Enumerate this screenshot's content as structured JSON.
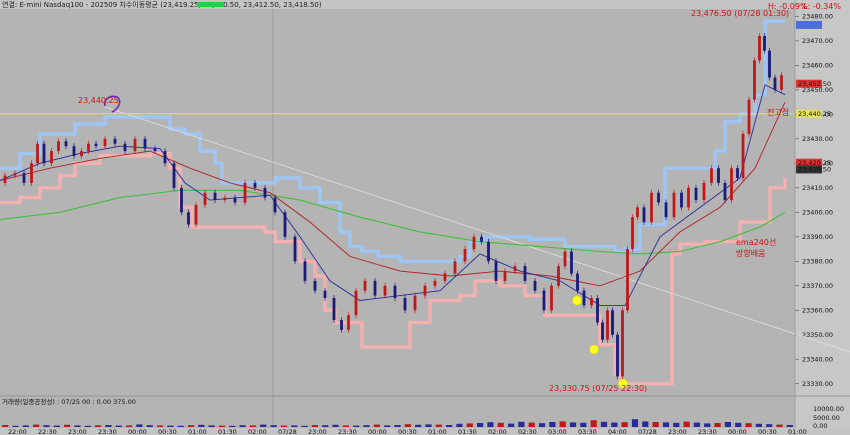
{
  "header": {
    "title": "연결: E-mini Nasdaq100 - 202509 차수이동평균  (23,419.25, 23,420.50, 23,412.50, 23,418.50)",
    "status_color": "#2ecc40"
  },
  "price_panel": {
    "high_label": "H: -0.09%",
    "low_label": "L: -0.34%",
    "last_label": "23,476.50 (07/28 01:30)",
    "low_annotation": "23,330.75 (07/25 22:30)",
    "level_label": "23,440.25",
    "level_left_label": "23,440.25",
    "red_badge_top": "23,452.50",
    "red_badge_mid": "23,420.25",
    "red_badge_mid2": "23,419.50",
    "annotation_high": "전고점",
    "annotation_ema_line1": "ema240선",
    "annotation_ema_line2": "방향배움"
  },
  "volume_panel": {
    "title": "거래량(일중공정성) : 07/25 00 : 0.00  375.00",
    "tick_labels": [
      "10000.00",
      "5000.00",
      "0.00"
    ]
  },
  "chart_data": {
    "type": "line",
    "ylim": [
      23325,
      23483
    ],
    "yticks": [
      23330,
      23340,
      23350,
      23360,
      23370,
      23380,
      23390,
      23400,
      23410,
      23420,
      23430,
      23440,
      23450,
      23460,
      23470,
      23480
    ],
    "xlabels": [
      "22:00",
      "22:30",
      "23:00",
      "23:30",
      "00:00",
      "00:30",
      "01:00",
      "01:30",
      "02:00",
      "07/28",
      "23:00",
      "23:30",
      "00:00",
      "00:30",
      "01:00",
      "01:30",
      "02:00",
      "02:30",
      "03:00",
      "03:30",
      "04:00",
      "07/28",
      "23:00",
      "23:30",
      "00:00",
      "00:30",
      "01:00"
    ],
    "key_level": 23440.25,
    "price": [
      [
        0,
        23412
      ],
      [
        10,
        23415
      ],
      [
        20,
        23416
      ],
      [
        28,
        23412
      ],
      [
        35,
        23420
      ],
      [
        40,
        23428
      ],
      [
        48,
        23420
      ],
      [
        55,
        23425
      ],
      [
        62,
        23429
      ],
      [
        70,
        23427
      ],
      [
        78,
        23423
      ],
      [
        85,
        23425
      ],
      [
        92,
        23428
      ],
      [
        100,
        23427
      ],
      [
        110,
        23430
      ],
      [
        120,
        23428
      ],
      [
        130,
        23425
      ],
      [
        140,
        23430
      ],
      [
        150,
        23426
      ],
      [
        160,
        23425
      ],
      [
        170,
        23420
      ],
      [
        178,
        23410
      ],
      [
        185,
        23400
      ],
      [
        192,
        23395
      ],
      [
        200,
        23403
      ],
      [
        210,
        23408
      ],
      [
        220,
        23405
      ],
      [
        230,
        23406
      ],
      [
        240,
        23404
      ],
      [
        250,
        23412
      ],
      [
        260,
        23410
      ],
      [
        270,
        23406
      ],
      [
        280,
        23400
      ],
      [
        290,
        23390
      ],
      [
        300,
        23380
      ],
      [
        310,
        23372
      ],
      [
        320,
        23368
      ],
      [
        330,
        23365
      ],
      [
        338,
        23356
      ],
      [
        345,
        23352
      ],
      [
        352,
        23358
      ],
      [
        360,
        23368
      ],
      [
        370,
        23372
      ],
      [
        380,
        23366
      ],
      [
        390,
        23370
      ],
      [
        400,
        23365
      ],
      [
        410,
        23360
      ],
      [
        420,
        23366
      ],
      [
        430,
        23370
      ],
      [
        440,
        23372
      ],
      [
        450,
        23375
      ],
      [
        460,
        23380
      ],
      [
        470,
        23385
      ],
      [
        478,
        23390
      ],
      [
        485,
        23388
      ],
      [
        492,
        23380
      ],
      [
        500,
        23372
      ],
      [
        510,
        23376
      ],
      [
        520,
        23378
      ],
      [
        530,
        23372
      ],
      [
        540,
        23368
      ],
      [
        548,
        23360
      ],
      [
        555,
        23370
      ],
      [
        562,
        23378
      ],
      [
        568,
        23384
      ],
      [
        575,
        23375
      ],
      [
        580,
        23368
      ],
      [
        588,
        23362
      ],
      [
        595,
        23365
      ],
      [
        600,
        23355
      ],
      [
        605,
        23348
      ],
      [
        610,
        23360
      ],
      [
        615,
        23350
      ],
      [
        620,
        23333
      ],
      [
        625,
        23360
      ],
      [
        630,
        23385
      ],
      [
        635,
        23398
      ],
      [
        640,
        23402
      ],
      [
        648,
        23396
      ],
      [
        655,
        23408
      ],
      [
        662,
        23404
      ],
      [
        670,
        23398
      ],
      [
        678,
        23408
      ],
      [
        685,
        23402
      ],
      [
        692,
        23410
      ],
      [
        700,
        23405
      ],
      [
        708,
        23412
      ],
      [
        715,
        23418
      ],
      [
        722,
        23412
      ],
      [
        728,
        23405
      ],
      [
        735,
        23418
      ],
      [
        740,
        23414
      ],
      [
        746,
        23432
      ],
      [
        752,
        23446
      ],
      [
        757,
        23462
      ],
      [
        762,
        23472
      ],
      [
        767,
        23466
      ],
      [
        772,
        23455
      ],
      [
        778,
        23450
      ],
      [
        785,
        23456
      ]
    ],
    "ema_fast": [
      [
        0,
        23413
      ],
      [
        40,
        23420
      ],
      [
        80,
        23424
      ],
      [
        120,
        23427
      ],
      [
        160,
        23426
      ],
      [
        185,
        23412
      ],
      [
        210,
        23405
      ],
      [
        240,
        23406
      ],
      [
        270,
        23407
      ],
      [
        300,
        23390
      ],
      [
        330,
        23372
      ],
      [
        360,
        23364
      ],
      [
        400,
        23366
      ],
      [
        440,
        23368
      ],
      [
        480,
        23383
      ],
      [
        520,
        23376
      ],
      [
        560,
        23372
      ],
      [
        600,
        23362
      ],
      [
        625,
        23362
      ],
      [
        660,
        23390
      ],
      [
        700,
        23402
      ],
      [
        740,
        23414
      ],
      [
        765,
        23452
      ],
      [
        785,
        23448
      ]
    ],
    "ema_slow": [
      [
        0,
        23413
      ],
      [
        50,
        23418
      ],
      [
        100,
        23422
      ],
      [
        150,
        23425
      ],
      [
        190,
        23418
      ],
      [
        230,
        23412
      ],
      [
        270,
        23408
      ],
      [
        310,
        23396
      ],
      [
        350,
        23382
      ],
      [
        400,
        23376
      ],
      [
        450,
        23374
      ],
      [
        500,
        23376
      ],
      [
        550,
        23374
      ],
      [
        600,
        23370
      ],
      [
        640,
        23376
      ],
      [
        680,
        23392
      ],
      [
        720,
        23402
      ],
      [
        755,
        23418
      ],
      [
        785,
        23445
      ]
    ],
    "ema240": [
      [
        0,
        23397
      ],
      [
        60,
        23400
      ],
      [
        120,
        23406
      ],
      [
        180,
        23409
      ],
      [
        240,
        23409
      ],
      [
        300,
        23405
      ],
      [
        360,
        23398
      ],
      [
        420,
        23392
      ],
      [
        480,
        23388
      ],
      [
        540,
        23386
      ],
      [
        600,
        23384
      ],
      [
        640,
        23383
      ],
      [
        680,
        23384
      ],
      [
        720,
        23388
      ],
      [
        760,
        23394
      ],
      [
        785,
        23400
      ]
    ],
    "band_upper": [
      [
        0,
        23418
      ],
      [
        20,
        23424
      ],
      [
        40,
        23432
      ],
      [
        75,
        23436
      ],
      [
        105,
        23439
      ],
      [
        155,
        23439
      ],
      [
        170,
        23434
      ],
      [
        185,
        23432
      ],
      [
        200,
        23425
      ],
      [
        215,
        23420
      ],
      [
        222,
        23412
      ],
      [
        275,
        23414
      ],
      [
        300,
        23410
      ],
      [
        320,
        23404
      ],
      [
        340,
        23392
      ],
      [
        350,
        23386
      ],
      [
        362,
        23384
      ],
      [
        378,
        23382
      ],
      [
        400,
        23380
      ],
      [
        430,
        23380
      ],
      [
        460,
        23382
      ],
      [
        470,
        23388
      ],
      [
        485,
        23390
      ],
      [
        530,
        23389
      ],
      [
        565,
        23386
      ],
      [
        600,
        23386
      ],
      [
        615,
        23384
      ],
      [
        625,
        23385
      ],
      [
        640,
        23395
      ],
      [
        665,
        23418
      ],
      [
        705,
        23418
      ],
      [
        715,
        23425
      ],
      [
        725,
        23437
      ],
      [
        740,
        23440
      ],
      [
        755,
        23448
      ],
      [
        765,
        23478
      ],
      [
        785,
        23478
      ]
    ],
    "band_lower": [
      [
        0,
        23404
      ],
      [
        20,
        23406
      ],
      [
        40,
        23410
      ],
      [
        60,
        23415
      ],
      [
        75,
        23420
      ],
      [
        100,
        23423
      ],
      [
        150,
        23424
      ],
      [
        170,
        23418
      ],
      [
        180,
        23402
      ],
      [
        192,
        23394
      ],
      [
        230,
        23394
      ],
      [
        265,
        23392
      ],
      [
        275,
        23388
      ],
      [
        300,
        23380
      ],
      [
        315,
        23374
      ],
      [
        325,
        23360
      ],
      [
        335,
        23355
      ],
      [
        362,
        23345
      ],
      [
        405,
        23345
      ],
      [
        410,
        23355
      ],
      [
        430,
        23364
      ],
      [
        460,
        23366
      ],
      [
        475,
        23372
      ],
      [
        500,
        23370
      ],
      [
        525,
        23366
      ],
      [
        545,
        23358
      ],
      [
        590,
        23358
      ],
      [
        600,
        23346
      ],
      [
        615,
        23334
      ],
      [
        620,
        23330
      ],
      [
        665,
        23330
      ],
      [
        672,
        23383
      ],
      [
        680,
        23387
      ],
      [
        705,
        23388
      ],
      [
        740,
        23396
      ],
      [
        770,
        23410
      ],
      [
        785,
        23414
      ]
    ],
    "trend_line": [
      [
        105,
        23443
      ],
      [
        850,
        23343
      ]
    ],
    "markers": [
      [
        577,
        23364
      ],
      [
        594,
        23344
      ],
      [
        623,
        23330
      ]
    ],
    "volume_max": 10000,
    "volume": [
      1000,
      600,
      800,
      1200,
      900,
      700,
      1100,
      800,
      600,
      900,
      1000,
      700,
      800,
      1300,
      900,
      800,
      700,
      600,
      900,
      1100,
      800,
      700,
      600,
      900,
      800,
      1200,
      900,
      700,
      800,
      600,
      1000,
      900,
      1100,
      800,
      700,
      900,
      1200,
      800,
      1000,
      1400,
      1100,
      1300,
      1200,
      1000,
      1600,
      1800,
      2000,
      2400,
      2100,
      1700,
      2600,
      2200,
      1900,
      2500,
      2800,
      2300,
      2100,
      3400,
      2600,
      2200,
      2400,
      3900,
      2800,
      2500,
      2300,
      2100,
      2700,
      2200,
      1800,
      2000,
      2500,
      2100,
      1900,
      1600,
      1400,
      1200,
      1000
    ]
  }
}
